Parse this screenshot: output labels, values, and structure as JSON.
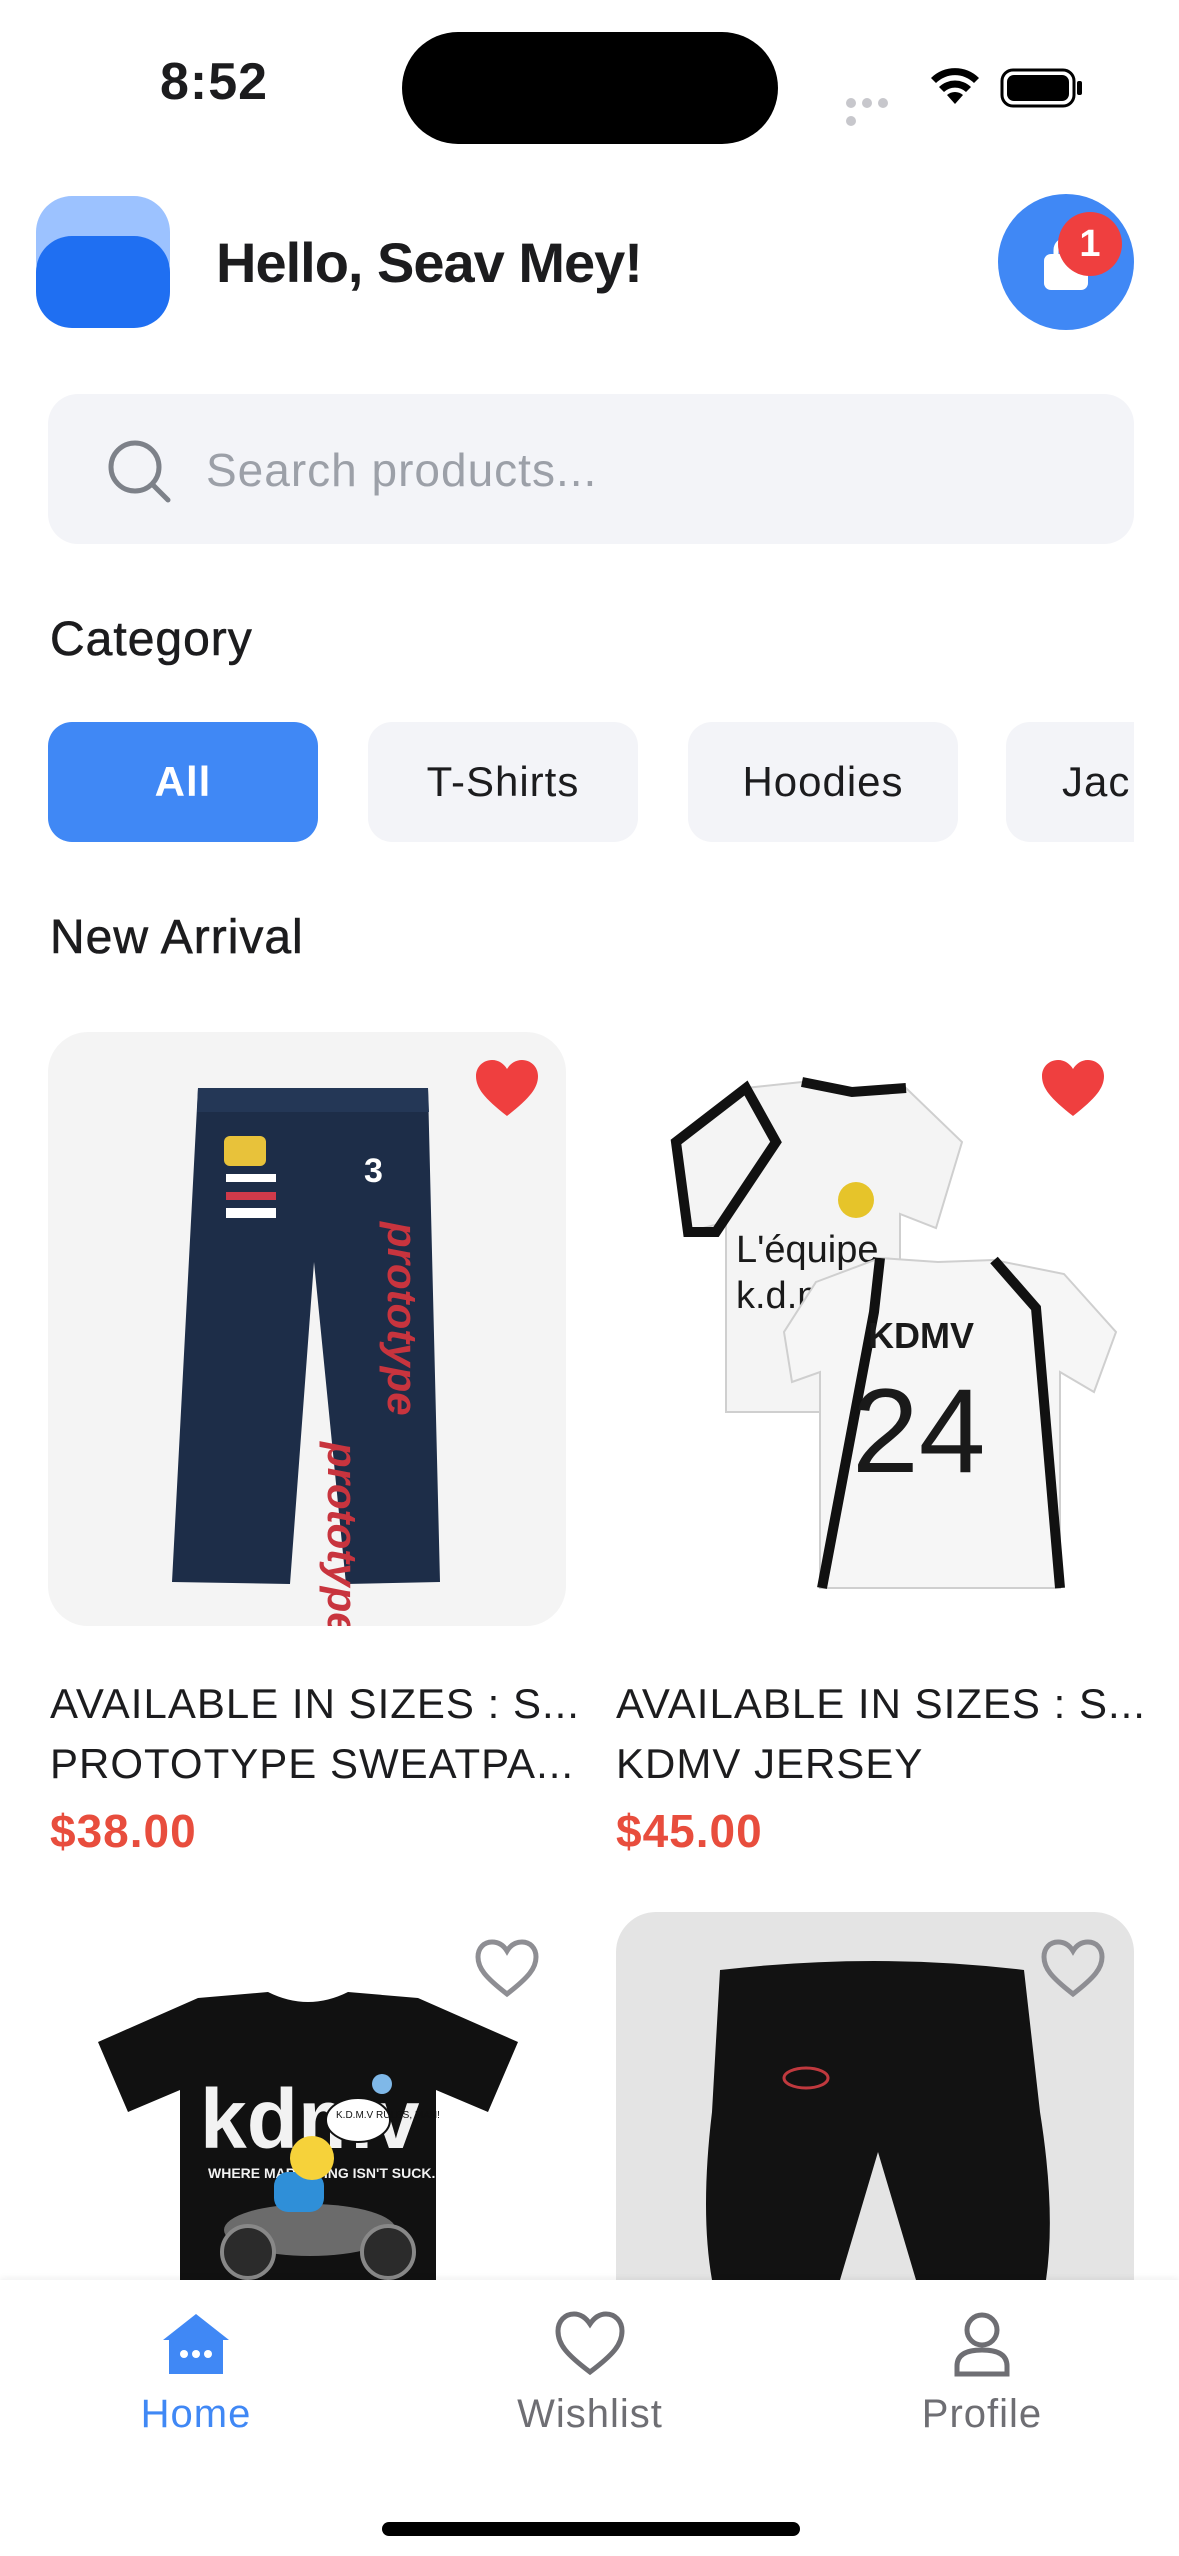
{
  "status_bar": {
    "time": "8:52"
  },
  "header": {
    "greeting": "Hello, Seav Mey!",
    "cart_badge": "1"
  },
  "search": {
    "placeholder": "Search products...",
    "value": ""
  },
  "category": {
    "title": "Category",
    "chips": [
      {
        "label": "All",
        "active": true
      },
      {
        "label": "T-Shirts",
        "active": false
      },
      {
        "label": "Hoodies",
        "active": false
      },
      {
        "label": "Jac",
        "active": false
      }
    ]
  },
  "new_arrival": {
    "title": "New Arrival",
    "products": [
      {
        "line1": "AVAILABLE IN SIZES : S...",
        "line2": "PROTOTYPE SWEATPA...",
        "price": "$38.00",
        "wishlisted": true
      },
      {
        "line1": "AVAILABLE IN SIZES : S...",
        "line2": "KDMV JERSEY",
        "price": "$45.00",
        "wishlisted": true
      },
      {
        "wishlisted": false
      },
      {
        "wishlisted": false
      }
    ]
  },
  "product_images": {
    "pants_text": "prototype",
    "pants_number": "3",
    "jersey_front_text": "L'équipe",
    "jersey_front_sub": "k.d.m.v",
    "jersey_back_name": "KDMV",
    "jersey_back_number": "24",
    "tee_logo": "kdmv",
    "tee_tag": "WHERE MARKETING ISN'T SUCK.",
    "tee_bubble": "K.D.M.V RULES, MAN!"
  },
  "bottom_nav": {
    "items": [
      {
        "label": "Home",
        "active": true
      },
      {
        "label": "Wishlist",
        "active": false
      },
      {
        "label": "Profile",
        "active": false
      }
    ]
  },
  "colors": {
    "accent": "#4088f5",
    "price": "#e84d3d",
    "heart": "#ef3f3f",
    "chip_bg": "#f3f4f8"
  }
}
